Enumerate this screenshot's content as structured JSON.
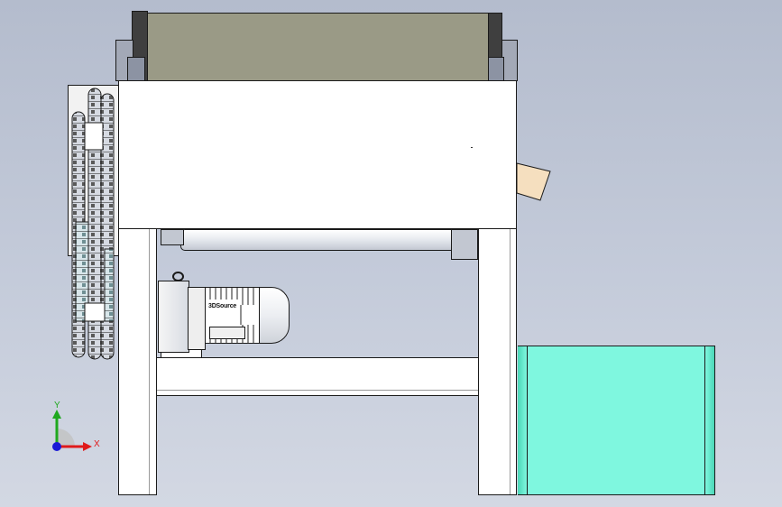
{
  "viewport": {
    "colors": {
      "background_top": "#b4bccd",
      "background_bottom": "#d3d8e3",
      "frame": "#ffffff",
      "outline": "#1a1a1a",
      "belt_surface": "#9a9a86",
      "hopper": "#7ff7df",
      "chute": "#f5dfbf",
      "side_plate": "#8c93a3"
    }
  },
  "motor": {
    "brand_label": "3DSource"
  },
  "triad": {
    "y_label": "Y",
    "x_label": "X",
    "y_color": "#1fa81f",
    "x_color": "#e01a1a",
    "z_color": "#1a1ad6"
  }
}
